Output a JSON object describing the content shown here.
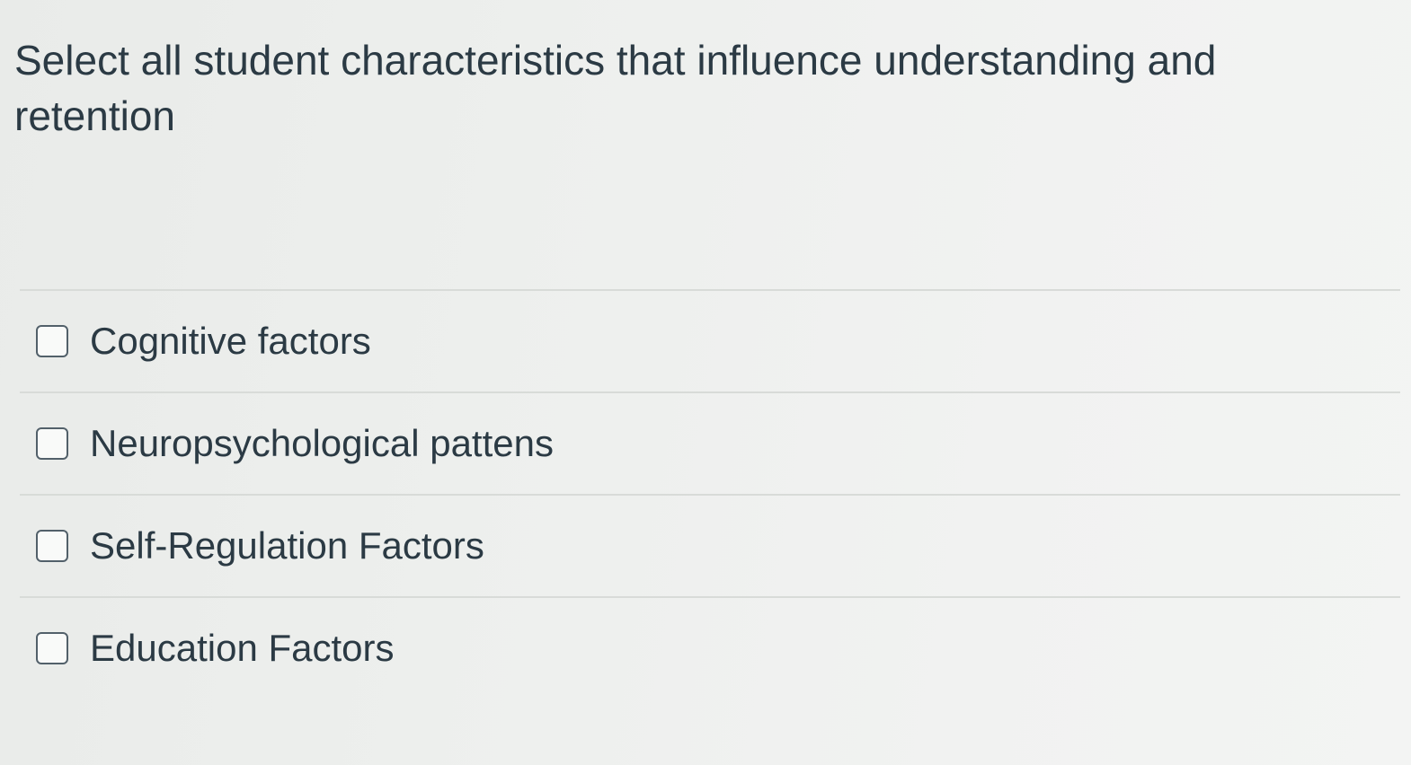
{
  "question": {
    "text": "Select all student characteristics that influence understanding and retention"
  },
  "answers": [
    {
      "label": "Cognitive factors",
      "checked": false
    },
    {
      "label": "Neuropsychological pattens",
      "checked": false
    },
    {
      "label": "Self-Regulation Factors",
      "checked": false
    },
    {
      "label": "Education Factors",
      "checked": false
    }
  ]
}
